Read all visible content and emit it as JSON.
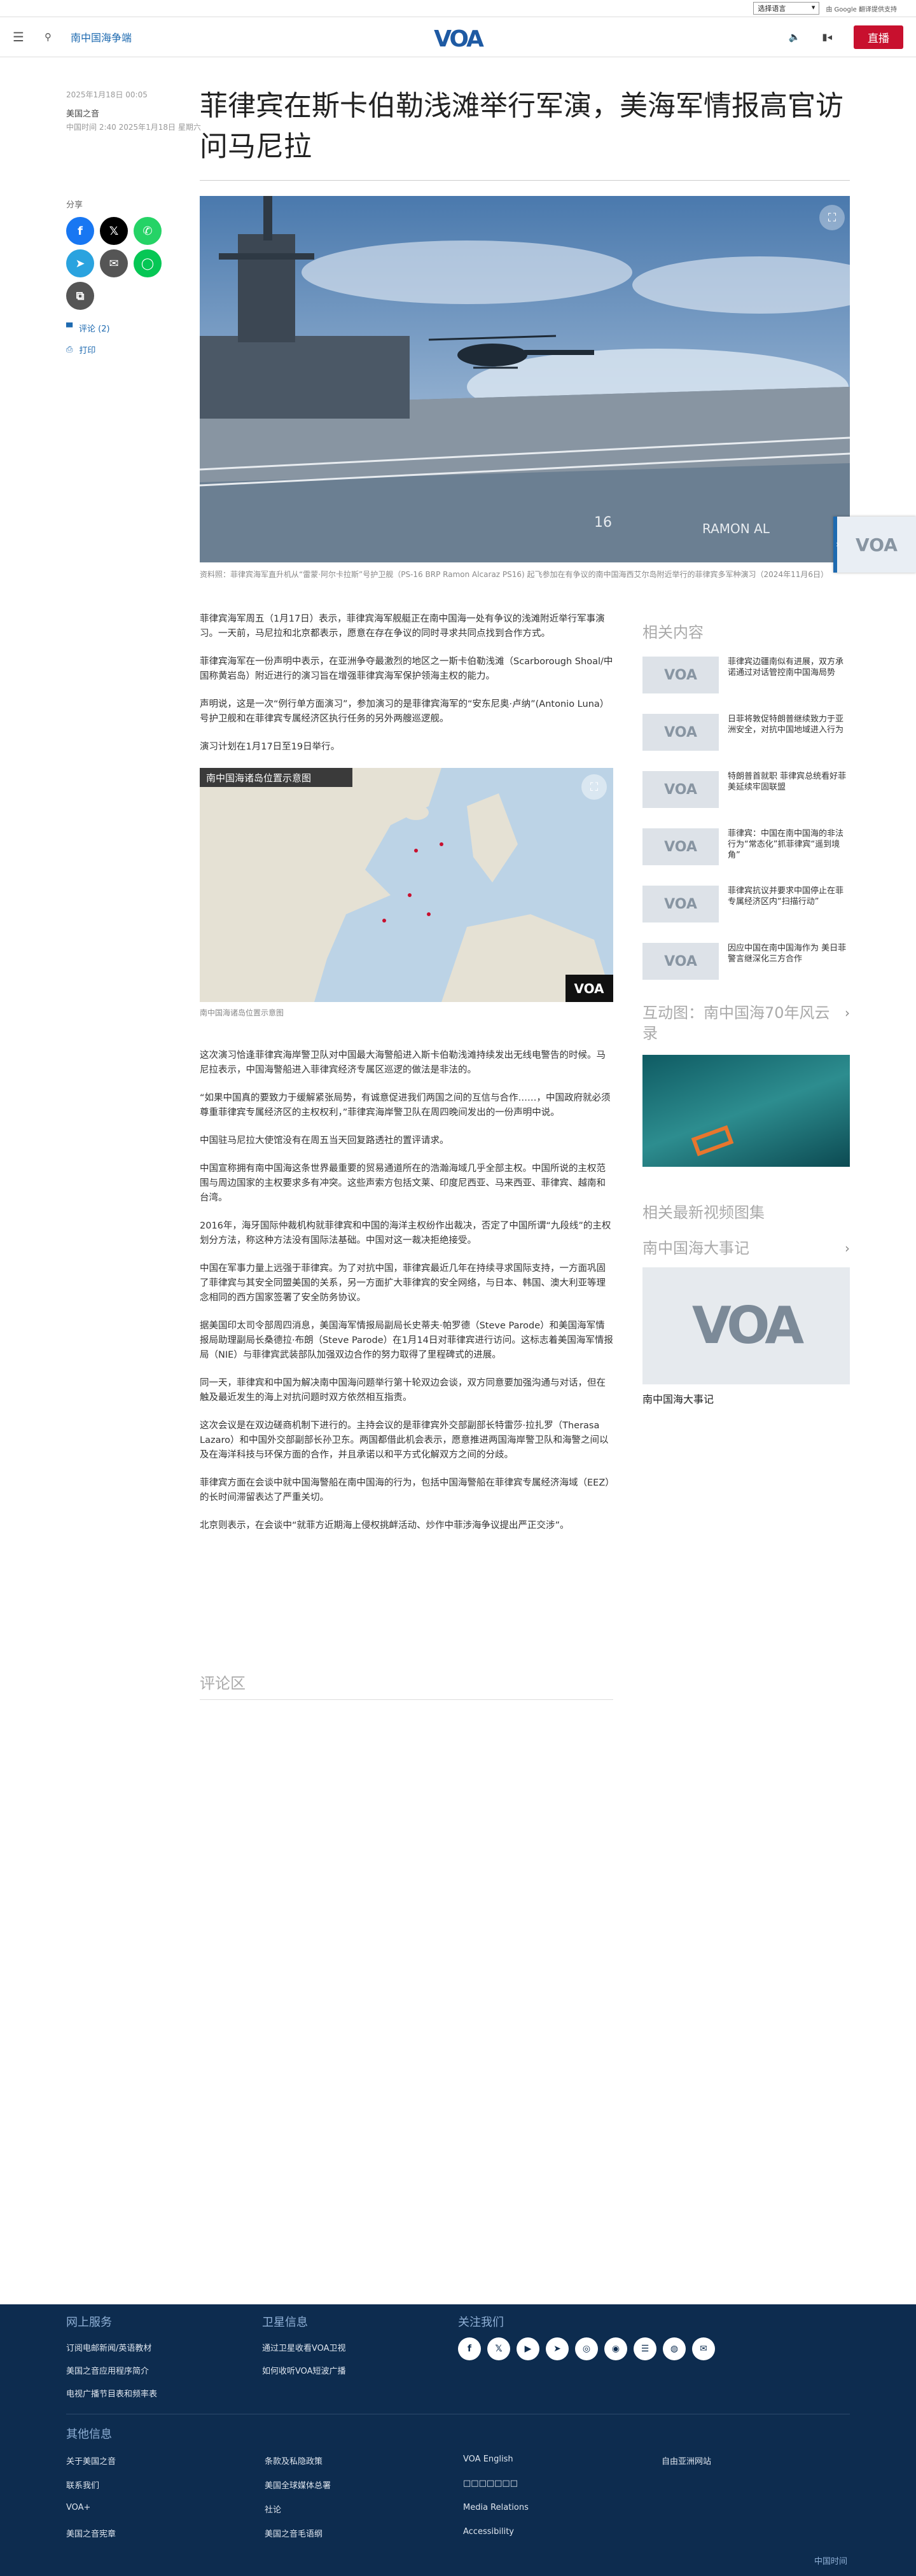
{
  "langbar": {
    "select_label": "选择语言",
    "powered_by": "由 Google 翻译提供支持"
  },
  "header": {
    "section": "南中国海争端",
    "live": "直播",
    "logo": "VOA"
  },
  "meta": {
    "top": "中国时间 2:40 2025年1月18日 星期六",
    "published": "2025年1月18日 00:05",
    "byline": "美国之音"
  },
  "title": "菲律宾在斯卡伯勒浅滩举行军演，美海军情报高官访问马尼拉",
  "share": {
    "label": "分享",
    "comments_link": "评论 (2)",
    "print_link": "打印"
  },
  "hero": {
    "caption": "资料照：菲律宾海军直升机从“雷蒙·阿尔卡拉斯”号护卫舰（PS-16 BRP Ramon Alcaraz PS16) 起飞参加在有争议的南中国海西艾尔岛附近举行的菲律宾多军种演习（2024年11月6日）",
    "hull": "16",
    "ship_name": "RAMON AL"
  },
  "map": {
    "title": "南中国海诸岛位置示意图",
    "caption": "南中国海诸岛位置示意图",
    "logo": "VOA"
  },
  "article_p1": [
    "菲律宾海军周五（1月17日）表示，菲律宾海军舰艇正在南中国海一处有争议的浅滩附近举行军事演习。一天前，马尼拉和北京都表示，愿意在存在争议的同时寻求共同点找到合作方式。",
    "菲律宾海军在一份声明中表示，在亚洲争夺最激烈的地区之一斯卡伯勒浅滩（Scarborough Shoal/中国称黄岩岛）附近进行的演习旨在增强菲律宾海军保护领海主权的能力。",
    "声明说，这是一次“例行单方面演习”，参加演习的是菲律宾海军的“安东尼奥·卢纳”(Antonio Luna）号护卫舰和在菲律宾专属经济区执行任务的另外两艘巡逻舰。",
    "演习计划在1月17日至19日举行。"
  ],
  "article_p2": [
    "这次演习恰逢菲律宾海岸警卫队对中国最大海警船进入斯卡伯勒浅滩持续发出无线电警告的时候。马尼拉表示，中国海警船进入菲律宾经济专属区巡逻的做法是非法的。",
    "“如果中国真的要致力于缓解紧张局势，有诚意促进我们两国之间的互信与合作……，中国政府就必须尊重菲律宾专属经济区的主权权利，”菲律宾海岸警卫队在周四晚间发出的一份声明中说。",
    "中国驻马尼拉大使馆没有在周五当天回复路透社的置评请求。",
    "中国宣称拥有南中国海这条世界最重要的贸易通道所在的浩瀚海域几乎全部主权。中国所说的主权范围与周边国家的主权要求多有冲突。这些声索方包括文莱、印度尼西亚、马来西亚、菲律宾、越南和台湾。",
    "2016年，海牙国际仲裁机构就菲律宾和中国的海洋主权纷作出裁决，否定了中国所谓“九段线”的主权划分方法，称这种方法没有国际法基础。中国对这一裁决拒绝接受。",
    "中国在军事力量上远强于菲律宾。为了对抗中国，菲律宾最近几年在持续寻求国际支持，一方面巩固了菲律宾与其安全同盟美国的关系，另一方面扩大菲律宾的安全网络，与日本、韩国、澳大利亚等理念相同的西方国家签署了安全防务协议。",
    "据美国印太司令部周四消息，美国海军情报局副局长史蒂夫·帕罗德（Steve Parode）和美国海军情报局助理副局长桑德拉·布朗（Steve Parode）在1月14日对菲律宾进行访问。这标志着美国海军情报局（NIE）与菲律宾武装部队加强双边合作的努力取得了里程碑式的进展。",
    "同一天，菲律宾和中国为解决南中国海问题举行第十轮双边会谈，双方同意要加强沟通与对话，但在触及最近发生的海上对抗问题时双方依然相互指责。",
    "这次会议是在双边磋商机制下进行的。主持会议的是菲律宾外交部副部长特雷莎·拉扎罗（Therasa Lazaro）和中国外交部副部长孙卫东。两国都借此机会表示，愿意推进两国海岸警卫队和海警之间以及在海洋科技与环保方面的合作，并且承诺以和平方式化解双方之间的分歧。",
    "菲律宾方面在会谈中就中国海警船在南中国海的行为，包括中国海警船在菲律宾专属经济海域（EEZ）的长时间滞留表达了严重关切。",
    "北京则表示，在会谈中“就菲方近期海上侵权挑衅活动、炒作中菲涉海争议提出严正交涉”。"
  ],
  "comments_title": "评论区",
  "rail": {
    "related_title": "相关内容",
    "related": [
      "菲律宾边疆南似有进展，双方承诺通过对话管控南中国海局势",
      "日菲将敦促特朗普继续致力于亚洲安全，对抗中国地域进入行为",
      "特朗普首就职 菲律宾总统看好菲美延续牢固联盟",
      "菲律宾：中国在南中国海的非法行为“常态化”抓菲律宾“遥到境角”",
      "菲律宾抗议并要求中国停止在菲专属经济区内“扫描行动”",
      "因应中国在南中国海作为 美日菲警言继深化三方合作"
    ],
    "interactive_title": "互动图：南中国海70年风云录",
    "video_title": "相关最新视频图集",
    "timeline_title": "南中国海大事记",
    "timeline_caption": "南中国海大事记"
  },
  "footer": {
    "online_title": "网上服务",
    "online": [
      "订阅电邮新闻/英语教材",
      "美国之音应用程序简介",
      "电视广播节目表和频率表"
    ],
    "sat_title": "卫星信息",
    "sat": [
      "通过卫星收看VOA卫视",
      "如何收听VOA短波广播"
    ],
    "follow_title": "关注我们",
    "other_title": "其他信息",
    "other_col1": [
      "关于美国之音",
      "联系我们",
      "VOA+",
      "美国之音宪章"
    ],
    "other_col2": [
      "条款及私隐政策",
      "美国全球媒体总署",
      "社论",
      "美国之音毛语纲"
    ],
    "other_col3": [
      "VOA English",
      "□□□□□□□",
      "Media Relations",
      "Accessibility"
    ],
    "other_col4": [
      "自由亚洲网站"
    ],
    "time": "中国时间"
  },
  "colors": {
    "accent": "#1e6ab0",
    "live": "#c8102e",
    "footer": "#0d2c4f"
  }
}
